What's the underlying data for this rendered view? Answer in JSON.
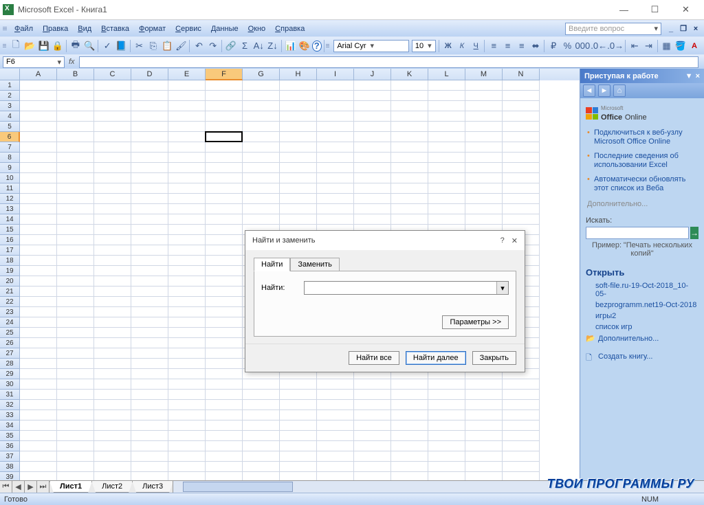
{
  "window": {
    "title": "Microsoft Excel - Книга1"
  },
  "menus": [
    "Файл",
    "Правка",
    "Вид",
    "Вставка",
    "Формат",
    "Сервис",
    "Данные",
    "Окно",
    "Справка"
  ],
  "helpbox_placeholder": "Введите вопрос",
  "font": {
    "name": "Arial Cyr",
    "size": "10"
  },
  "namebox": "F6",
  "columns": [
    "A",
    "B",
    "C",
    "D",
    "E",
    "F",
    "G",
    "H",
    "I",
    "J",
    "K",
    "L",
    "M",
    "N"
  ],
  "active_col": "F",
  "active_row": 6,
  "row_count": 39,
  "sheets": [
    "Лист1",
    "Лист2",
    "Лист3"
  ],
  "active_sheet": "Лист1",
  "status": {
    "ready": "Готово",
    "num": "NUM"
  },
  "taskpane": {
    "title": "Приступая к работе",
    "office_brand": {
      "small": "Microsoft",
      "big_a": "Office",
      "big_b": "Online"
    },
    "links": [
      "Подключиться к веб-узлу Microsoft Office Online",
      "Последние сведения об использовании Excel",
      "Автоматически обновлять этот список из Веба"
    ],
    "more": "Дополнительно...",
    "search_label": "Искать:",
    "example_label": "Пример:",
    "example_text": "\"Печать нескольких копий\"",
    "open_title": "Открыть",
    "files": [
      "soft-file.ru-19-Oct-2018_10-05-",
      "bezprogramm.net19-Oct-2018",
      "игры2",
      "список игр"
    ],
    "more_open": "Дополнительно...",
    "new_book": "Создать книгу..."
  },
  "dialog": {
    "title": "Найти и заменить",
    "tabs": [
      "Найти",
      "Заменить"
    ],
    "find_label": "Найти:",
    "options": "Параметры >>",
    "find_all": "Найти все",
    "find_next": "Найти далее",
    "close": "Закрыть"
  },
  "watermark": "ТВОИ ПРОГРАММЫ РУ"
}
